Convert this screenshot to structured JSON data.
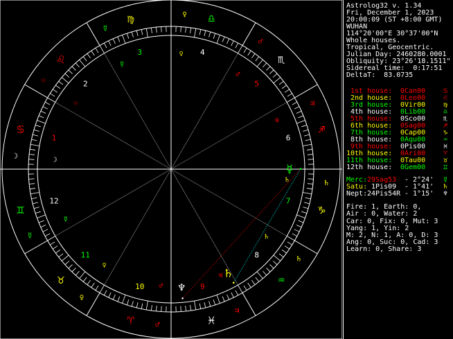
{
  "header": {
    "app": "Astrolog32 v. 1.34",
    "date": "Fri, December 1, 2023",
    "time": "20:00:09 (ST +8:00 GMT)",
    "place": "WUHAN",
    "coords": "114°20'00\"E 30°37'00\"N",
    "house_system": "Whole houses.",
    "zodiac": "Tropical, Geocentric.",
    "julian": "Julian Day: 2460280.0001",
    "obliquity": "Obliquity: 23°26'18.1511\"",
    "sidereal": "Sidereal time:  0:17:51",
    "deltat": "DeltaT:  83.0735"
  },
  "houses": [
    {
      "label": "1st house:",
      "value": "0Can00",
      "color": "#ff0000",
      "glyph": "♋"
    },
    {
      "label": "2nd house:",
      "value": "0Leo00",
      "color": "#ffff00",
      "value_color": "#ff0000",
      "glyph": "♌",
      "glyph_color": "#ff0000"
    },
    {
      "label": "3rd house:",
      "value": "0Vir00",
      "color": "#00ff00",
      "value_color": "#ffff00",
      "glyph": "♍",
      "glyph_color": "#ffff00"
    },
    {
      "label": "4th house:",
      "value": "0Lib00",
      "color": "#ffffff",
      "value_color": "#00ff00",
      "glyph": "♎",
      "glyph_color": "#00ff00"
    },
    {
      "label": "5th house:",
      "value": "0Sco00",
      "color": "#ff0000",
      "value_color": "#ffffff",
      "glyph": "♏",
      "glyph_color": "#ffffff"
    },
    {
      "label": "6th house:",
      "value": "0Sag00",
      "color": "#ffff00",
      "value_color": "#ff0000",
      "glyph": "♐",
      "glyph_color": "#ff0000"
    },
    {
      "label": "7th house:",
      "value": "0Cap00",
      "color": "#00ff00",
      "value_color": "#ffff00",
      "glyph": "♑",
      "glyph_color": "#ffff00"
    },
    {
      "label": "8th house:",
      "value": "0Aqu00",
      "color": "#ffffff",
      "value_color": "#00ff00",
      "glyph": "♒",
      "glyph_color": "#00ff00"
    },
    {
      "label": "9th house:",
      "value": "0Pis00",
      "color": "#ff0000",
      "value_color": "#ffffff",
      "glyph": "♓",
      "glyph_color": "#ffffff"
    },
    {
      "label": "10th house:",
      "value": "0Ari00",
      "color": "#ffff00",
      "value_color": "#ff0000",
      "glyph": "♈",
      "glyph_color": "#ff0000"
    },
    {
      "label": "11th house:",
      "value": "0Tau00",
      "color": "#00ff00",
      "value_color": "#ffff00",
      "glyph": "♉",
      "glyph_color": "#ffff00"
    },
    {
      "label": "12th house:",
      "value": "0Gem00",
      "color": "#ffffff",
      "value_color": "#00ff00",
      "glyph": "♊",
      "glyph_color": "#00ff00"
    }
  ],
  "planets": [
    {
      "name": "Merc:",
      "position": "29Sag53",
      "aspect": "- 2°24'",
      "name_color": "#00ff00",
      "pos_color": "#ff0000",
      "glyph": "☿",
      "glyph_color": "#00ff00"
    },
    {
      "name": "Satu:",
      "position": "1Pis09",
      "aspect": "- 1°41'",
      "name_color": "#ffff00",
      "pos_color": "#ffffff",
      "glyph": "♄",
      "glyph_color": "#ffff00"
    },
    {
      "name": "Nept:",
      "position": "24Pis54R",
      "aspect": "- 1°15'",
      "name_color": "#ffffff",
      "pos_color": "#ffffff",
      "glyph": "♆",
      "glyph_color": "#ffffff"
    }
  ],
  "stats": [
    "Fire: 1, Earth: 0,",
    "Air : 0, Water: 2",
    "Car: 0, Fix: 0, Mut: 3",
    "Yang: 1, Yin: 2",
    "M: 2, N: 1, A: 0, D: 3",
    "Ang: 0, Suc: 0, Cad: 3",
    "Learn: 0, Share: 3"
  ],
  "wheel": {
    "ascendant_sign_deg": 90,
    "house_numbers": [
      "1",
      "2",
      "3",
      "4",
      "5",
      "6",
      "7",
      "8",
      "9",
      "10",
      "11",
      "12"
    ],
    "house_number_colors": [
      "#ff0000",
      "#ffffff",
      "#00ff00",
      "#ffffff",
      "#ff0000",
      "#ffffff",
      "#00ff00",
      "#ffffff",
      "#ff0000",
      "#ffff00",
      "#00ff00",
      "#ffffff"
    ],
    "signs": [
      {
        "glyph": "♈",
        "color": "#ff0000"
      },
      {
        "glyph": "♉",
        "color": "#ffff00"
      },
      {
        "glyph": "♊",
        "color": "#00ff00"
      },
      {
        "glyph": "♋",
        "color": "#ff0000"
      },
      {
        "glyph": "♌",
        "color": "#ff0000"
      },
      {
        "glyph": "♍",
        "color": "#ffff00"
      },
      {
        "glyph": "♎",
        "color": "#00ff00"
      },
      {
        "glyph": "♏",
        "color": "#ffffff"
      },
      {
        "glyph": "♐",
        "color": "#ff0000"
      },
      {
        "glyph": "♑",
        "color": "#ffff00"
      },
      {
        "glyph": "♒",
        "color": "#00ff00"
      },
      {
        "glyph": "♓",
        "color": "#ffffff"
      }
    ],
    "rulers": [
      {
        "glyph": "♂",
        "color": "#ff0000"
      },
      {
        "glyph": "♀",
        "color": "#ffff00"
      },
      {
        "glyph": "☿",
        "color": "#00ff00"
      },
      {
        "glyph": "☽",
        "color": "#ffffff"
      },
      {
        "glyph": "☉",
        "color": "#ff0000"
      },
      {
        "glyph": "☿",
        "color": "#00ff00"
      },
      {
        "glyph": "♀",
        "color": "#ffff00"
      },
      {
        "glyph": "♂",
        "color": "#ff0000"
      },
      {
        "glyph": "♃",
        "color": "#ff0000"
      },
      {
        "glyph": "♄",
        "color": "#ffff00"
      },
      {
        "glyph": "♄",
        "color": "#ffff00"
      },
      {
        "glyph": "♃",
        "color": "#ff0000"
      }
    ],
    "chart_planets": [
      {
        "glyph": "☿",
        "color": "#00ff00",
        "lon": 269.88
      },
      {
        "glyph": "♄",
        "color": "#ffff00",
        "lon": 331.15
      },
      {
        "glyph": "♆",
        "color": "#ffffff",
        "lon": 354.9
      }
    ],
    "aspect_lines": [
      {
        "from": 0,
        "to": 1,
        "color": "#00ffff",
        "style": "dotted"
      },
      {
        "from": 0,
        "to": 2,
        "color": "#ff0000",
        "style": "dotted"
      }
    ],
    "colors": {
      "line": "#ffffff",
      "background": "#000000"
    }
  }
}
